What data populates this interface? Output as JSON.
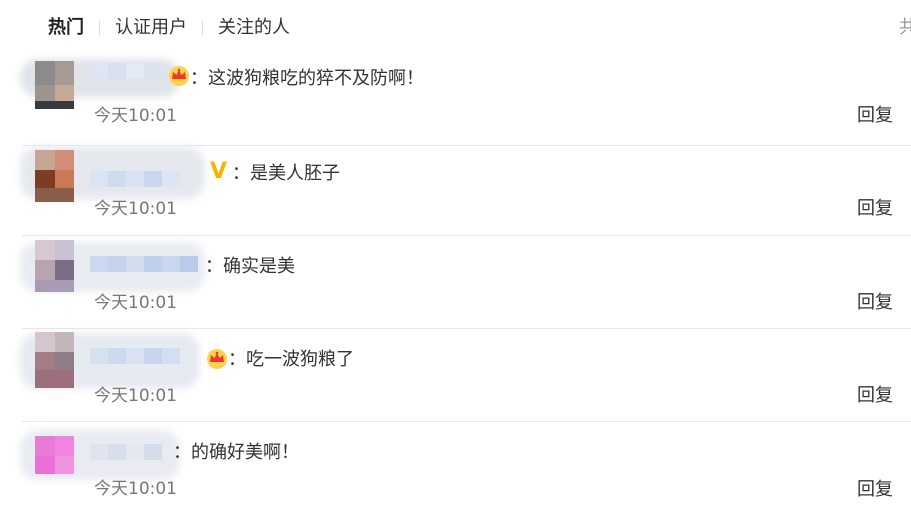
{
  "tabs": [
    {
      "label": "热门",
      "active": true
    },
    {
      "label": "认证用户",
      "active": false
    },
    {
      "label": "关注的人",
      "active": false
    }
  ],
  "total_label_partial": "共",
  "reply_label": "回复",
  "colors": {
    "accent": "#ff8200",
    "badge_gold": "#f7b500",
    "divider": "#e6e6e6"
  },
  "comments": [
    {
      "badge": "crown-icon",
      "text": "：这波狗粮吃的猝不及防啊！",
      "time": "今天10:01"
    },
    {
      "badge": "v-icon",
      "text": "：是美人胚子",
      "time": "今天10:01"
    },
    {
      "badge": "",
      "text": "：确实是美",
      "time": "今天10:01"
    },
    {
      "badge": "crown-icon",
      "text": "：吃一波狗粮了",
      "time": "今天10:01"
    },
    {
      "badge": "",
      "text": "：的确好美啊！",
      "time": "今天10:01"
    }
  ]
}
